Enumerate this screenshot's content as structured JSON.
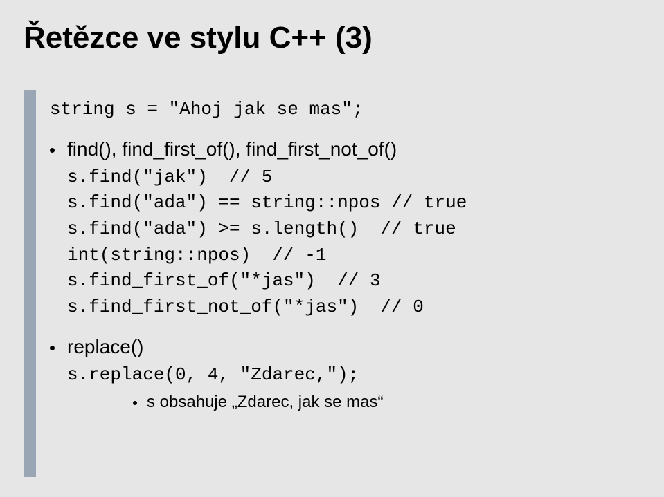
{
  "title": "Řetězce ve stylu C++ (3)",
  "decl": "string s = \"Ahoj jak se mas\";",
  "bullet1": "find(), find_first_of(), find_first_not_of()",
  "code1": [
    "s.find(\"jak\")  // 5",
    "s.find(\"ada\") == string::npos // true",
    "s.find(\"ada\") >= s.length()  // true",
    "int(string::npos)  // -1",
    "s.find_first_of(\"*jas\")  // 3",
    "s.find_first_not_of(\"*jas\")  // 0"
  ],
  "bullet2": "replace()",
  "code2": "s.replace(0, 4, \"Zdarec,\");",
  "sub": "s obsahuje „Zdarec, jak se mas“"
}
